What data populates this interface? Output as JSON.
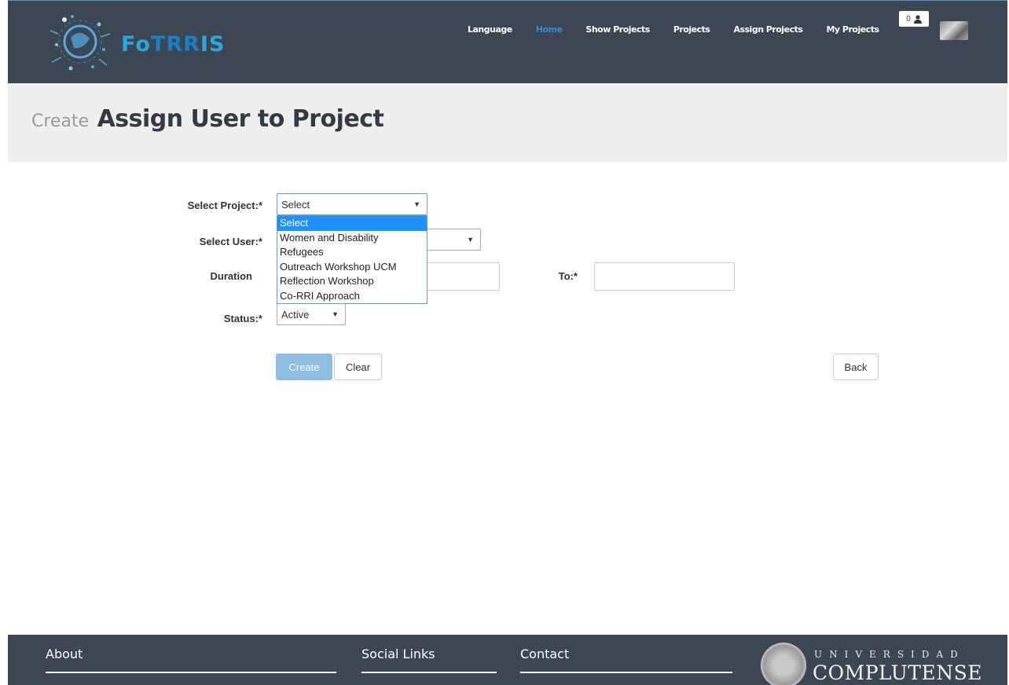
{
  "header": {
    "logo": {
      "fo": "Fo",
      "trr": "TRR",
      "is": "IS"
    },
    "nav": [
      "Language",
      "Home",
      "Show Projects",
      "Projects",
      "Assign Projects",
      "My Projects"
    ],
    "active_nav": "Home",
    "notification_count": "0"
  },
  "title": {
    "prefix": "Create",
    "main": "Assign User to Project"
  },
  "form": {
    "project_label": "Select Project:*",
    "project_value": "Select",
    "project_options": [
      "Select",
      "Women and Disability",
      "Refugees",
      "Outreach Workshop UCM",
      "Reflection Workshop",
      "Co-RRI Approach"
    ],
    "user_label": "Select User:*",
    "user_value": "",
    "duration_label": "Duration",
    "to_label": "To:*",
    "status_label": "Status:*",
    "status_value": "Active"
  },
  "buttons": {
    "create": "Create",
    "clear": "Clear",
    "back": "Back"
  },
  "footer": {
    "about": "About",
    "social": "Social Links",
    "contact": "Contact",
    "ucm_top": "UNIVERSIDAD",
    "ucm_bottom": "COMPLUTENSE"
  },
  "colors": {
    "navbar": "#3d4753",
    "accent": "#2f8fd8",
    "create_button": "#8dbde3"
  }
}
